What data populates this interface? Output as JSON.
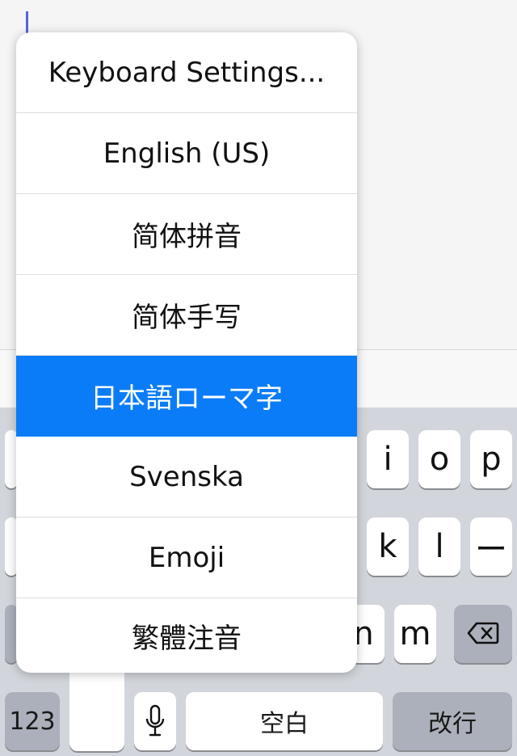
{
  "menu": {
    "items": [
      {
        "label": "Keyboard Settings..."
      },
      {
        "label": "English (US)"
      },
      {
        "label": "简体拼音"
      },
      {
        "label": "简体手写"
      },
      {
        "label": "日本語ローマ字",
        "selected": true
      },
      {
        "label": "Svenska"
      },
      {
        "label": "Emoji"
      },
      {
        "label": "繁體注音"
      }
    ]
  },
  "keyboard": {
    "row1": [
      "i",
      "o",
      "p"
    ],
    "row2": [
      "k",
      "l",
      "ー"
    ],
    "row3": [
      "n",
      "m"
    ],
    "bottom": {
      "numbers_label": "123",
      "space_label": "空白",
      "return_label": "改行"
    }
  },
  "icons": {
    "mic": "mic-icon",
    "delete": "delete-backspace-icon",
    "globe": "globe-key"
  },
  "colors": {
    "accent": "#0b7cf7",
    "keyboard_bg": "#d2d5db"
  }
}
